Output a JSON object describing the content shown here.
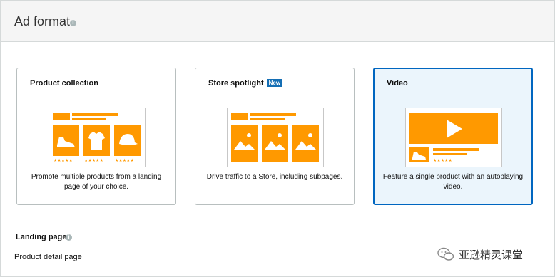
{
  "header": {
    "title": "Ad format",
    "info_icon": "i"
  },
  "cards": [
    {
      "title": "Product collection",
      "badge": "",
      "description": "Promote multiple products from a landing page of your choice.",
      "selected": false,
      "rating": "★★★★★"
    },
    {
      "title": "Store spotlight",
      "badge": "New",
      "description": "Drive traffic to a Store, including subpages.",
      "selected": false
    },
    {
      "title": "Video",
      "badge": "",
      "description": "Feature a single product with an autoplaying video.",
      "selected": true,
      "rating": "★★★★★"
    }
  ],
  "landing_page": {
    "label": "Landing page",
    "info_icon": "i",
    "value": "Product detail page"
  },
  "watermark": {
    "text": "亚逊精灵课堂"
  },
  "colors": {
    "accent": "#ff9900",
    "selected_border": "#0066c0",
    "selected_bg": "#ebf5fc",
    "badge": "#146eb4"
  }
}
